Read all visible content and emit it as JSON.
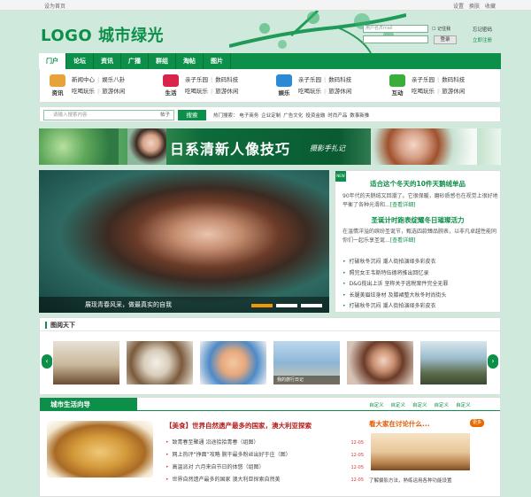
{
  "topbar": {
    "home": "设为首页",
    "settings": "设置",
    "skin": "换肤",
    "favorite": "收藏"
  },
  "header": {
    "logo": "LOGO 城市绿光"
  },
  "login": {
    "username_placeholder": "用户名/Email",
    "password_placeholder": "",
    "remember": "记住我",
    "login_button": "登录",
    "forgot": "忘记密码",
    "register": "立即注册"
  },
  "nav": [
    {
      "label": "门户",
      "active": true
    },
    {
      "label": "论坛",
      "active": false
    },
    {
      "label": "资讯",
      "active": false
    },
    {
      "label": "广播",
      "active": false
    },
    {
      "label": "群组",
      "active": false
    },
    {
      "label": "淘帖",
      "active": false
    },
    {
      "label": "图片",
      "active": false
    }
  ],
  "channels": [
    {
      "name": "资讯",
      "icon": "folder-icon",
      "color": "#e9a13b",
      "links": [
        "新闻中心",
        "娱乐八卦",
        "吃喝玩乐",
        "旅游休闲"
      ]
    },
    {
      "name": "生活",
      "icon": "heart-icon",
      "color": "#d9254b",
      "links": [
        "亲子乐园",
        "数码科技",
        "吃喝玩乐",
        "旅游休闲"
      ]
    },
    {
      "name": "娱乐",
      "icon": "camera-icon",
      "color": "#2a8ad6",
      "links": [
        "亲子乐园",
        "数码科技",
        "吃喝玩乐",
        "旅游休闲"
      ]
    },
    {
      "name": "互动",
      "icon": "chat-icon",
      "color": "#3aae3a",
      "links": [
        "亲子乐园",
        "数码科技",
        "吃喝玩乐",
        "旅游休闲"
      ]
    }
  ],
  "search": {
    "placeholder": "请输入搜索内容",
    "scope": "帖子",
    "button": "搜索",
    "hot_label": "热门搜索：",
    "hot": [
      "电子商务",
      "企业定制",
      "广告文化",
      "投资金融",
      "时尚产品",
      "数事新推"
    ]
  },
  "banner": {
    "title": "日系清新人像技巧",
    "subtitle": "摄影手扎记"
  },
  "hero": {
    "caption": "展现青春风采，做最真实的自我",
    "slide_active": 1,
    "slide_total": 3,
    "badge": "NEW",
    "article1_title": "适合这个冬天的10件天鹅绒单品",
    "article1_text": "90年代的天鹅绒又回潮了。它很保暖，磨砂质感也在视觉上很好地平衡了各种光滑和...",
    "article2_title": "圣诞计时跑表绽耀冬日璀璨活力",
    "article2_text": "在温情洋溢的缤纷圣诞节，甄选四款臻品腕表，以非凡卓越性能同你们一起乐享圣诞...",
    "more": "[查看详细]",
    "links": [
      "打破秋冬沉闷 潮人街拍演绎多彩皮衣",
      "照完女王韦斯特伍德将推出回忆录",
      "D&G揽出上诉 坚称关于逃税案件完全无罪",
      "长腿美眉炫身材 及膝裙整大秋冬时尚街头",
      "打破秋冬沉闷 潮人街拍演绎多彩皮衣"
    ]
  },
  "gallery": {
    "title": "图阅天下",
    "items": [
      {
        "caption": "",
        "icon": "room-photo"
      },
      {
        "caption": "",
        "icon": "tea-photo"
      },
      {
        "caption": "",
        "icon": "baby-photo"
      },
      {
        "caption": "我的旅行日记",
        "icon": "beach-photo"
      },
      {
        "caption": "",
        "icon": "girl-photo"
      },
      {
        "caption": "",
        "icon": "pagoda-photo"
      }
    ]
  },
  "life": {
    "title": "城市生活向导",
    "tags": [
      "自定义",
      "自定义",
      "自定义",
      "自定义",
      "自定义"
    ],
    "headline": "【美食】世界自然遗产最多的国家，澳大利亚探索",
    "list": [
      {
        "text": "致青春至聚通 沿途拾拾青春（组图）",
        "date": "12-05"
      },
      {
        "text": "网上热评“挣面”攻略 腕干最多粉丝出好于庄（图）",
        "date": "12-05"
      },
      {
        "text": "高温派对 六月来自节日的体悠（组图）",
        "date": "12-05"
      },
      {
        "text": "世界自然遗产最多的国家 澳大利亚探索自然美",
        "date": "12-05"
      }
    ],
    "discuss_title": "看大家在讨论什么...",
    "discuss_badge": "更多",
    "discuss_text": "了解摄影方法，熟练运用各种功能设置"
  }
}
